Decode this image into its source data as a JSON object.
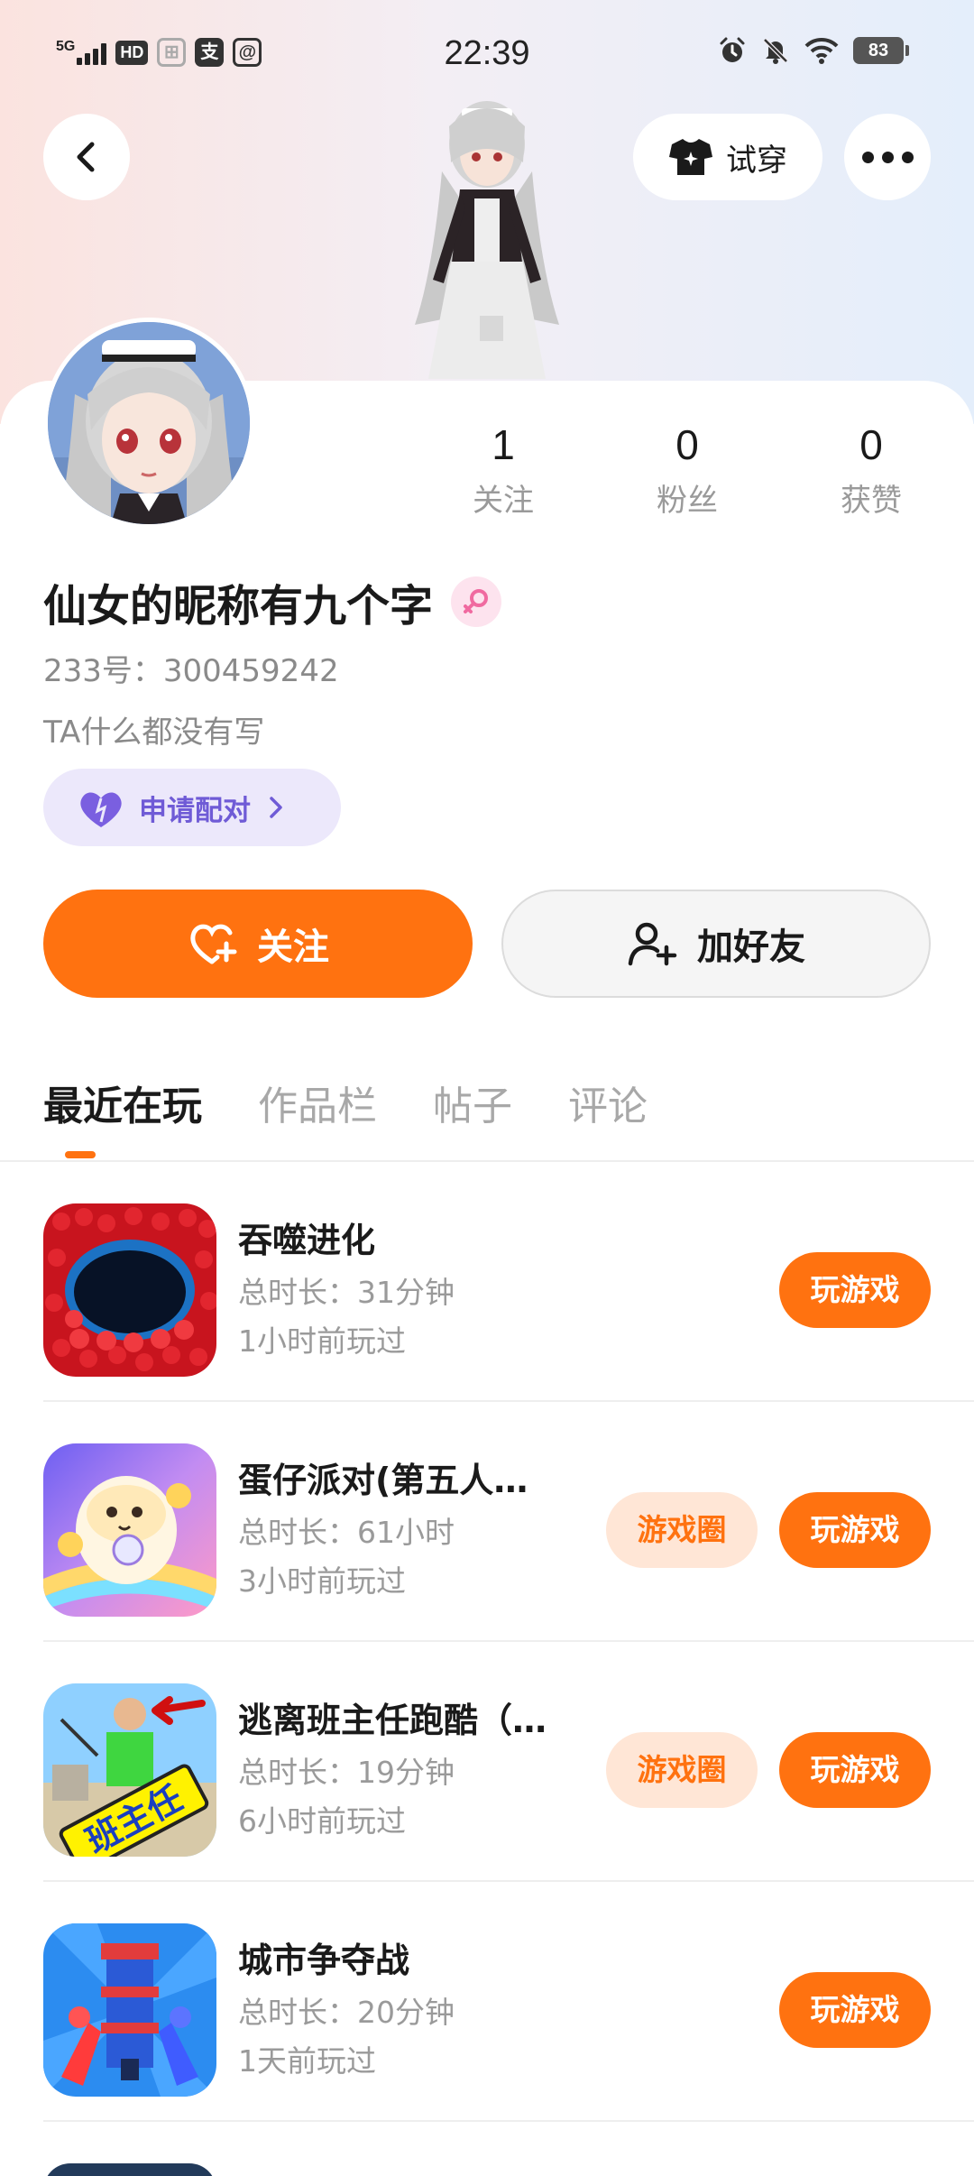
{
  "status_bar": {
    "network": "5G",
    "hd": "HD",
    "app_icon_1": "⊞",
    "app_icon_2": "支",
    "app_icon_3": "@",
    "time": "22:39",
    "battery": "83"
  },
  "top_bar": {
    "try_on_label": "试穿"
  },
  "profile": {
    "nickname": "仙女的昵称有九个字",
    "uid": "233号：300459242",
    "bio": "TA什么都没有写",
    "pair_label": "申请配对",
    "stats": [
      {
        "value": "1",
        "label": "关注"
      },
      {
        "value": "0",
        "label": "粉丝"
      },
      {
        "value": "0",
        "label": "获赞"
      }
    ],
    "follow_label": "关注",
    "add_friend_label": "加好友"
  },
  "tabs": [
    {
      "label": "最近在玩",
      "active": true
    },
    {
      "label": "作品栏",
      "active": false
    },
    {
      "label": "帖子",
      "active": false
    },
    {
      "label": "评论",
      "active": false
    }
  ],
  "games": [
    {
      "name": "吞噬进化",
      "total_time": "总时长：31分钟",
      "last_played": "1小时前玩过",
      "play_label": "玩游戏",
      "circle_label": ""
    },
    {
      "name": "蛋仔派对(第五人…",
      "total_time": "总时长：61小时",
      "last_played": "3小时前玩过",
      "play_label": "玩游戏",
      "circle_label": "游戏圈"
    },
    {
      "name": "逃离班主任跑酷（…",
      "total_time": "总时长：19分钟",
      "last_played": "6小时前玩过",
      "play_label": "玩游戏",
      "circle_label": "游戏圈"
    },
    {
      "name": "城市争夺战",
      "total_time": "总时长：20分钟",
      "last_played": "1天前玩过",
      "play_label": "玩游戏",
      "circle_label": ""
    }
  ],
  "game_icon_texts": {
    "game_3_icon_text": "班主任"
  },
  "colors": {
    "accent": "#ff7210",
    "pair_purple": "#6f5bd6",
    "circle_bg": "#ffe6d6"
  },
  "icons": {
    "back": "chevron-left-icon",
    "try_on": "tshirt-icon",
    "more": "more-dots-icon",
    "gender": "female-icon",
    "pair": "heart-icon",
    "follow": "heart-plus-icon",
    "add_friend": "person-add-icon"
  }
}
